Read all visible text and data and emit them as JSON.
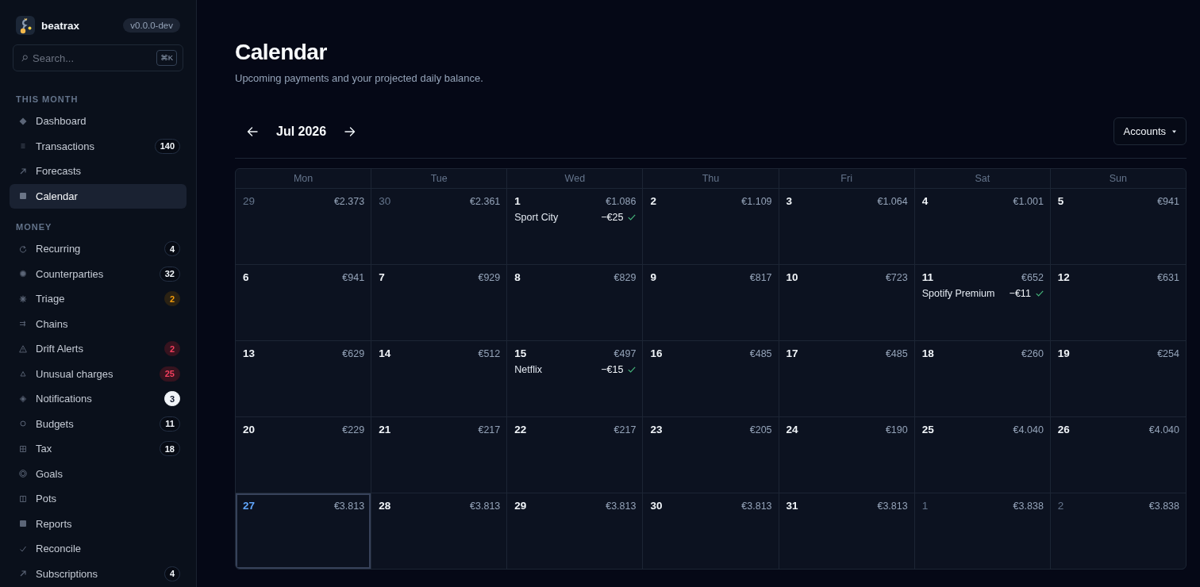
{
  "sidebar": {
    "brand": {
      "name": "beatrax",
      "version": "v0.0.0-dev"
    },
    "search": {
      "placeholder": "Search...",
      "shortcut": "⌘K"
    },
    "sections": [
      {
        "title": "THIS MONTH",
        "items": [
          {
            "label": "Dashboard",
            "selected": false
          },
          {
            "label": "Transactions",
            "selected": false,
            "badge": {
              "count": "140",
              "kind": "neutral"
            }
          },
          {
            "label": "Forecasts",
            "selected": false
          },
          {
            "label": "Calendar",
            "selected": true
          }
        ]
      },
      {
        "title": "MONEY",
        "items": [
          {
            "label": "Recurring",
            "selected": false,
            "badge": {
              "count": "4",
              "kind": "neutral"
            }
          },
          {
            "label": "Counterparties",
            "selected": false,
            "badge": {
              "count": "32",
              "kind": "neutral"
            }
          },
          {
            "label": "Triage",
            "selected": false,
            "badge": {
              "count": "2",
              "kind": "warning"
            }
          },
          {
            "label": "Chains",
            "selected": false
          },
          {
            "label": "Drift Alerts",
            "selected": false,
            "badge": {
              "count": "2",
              "kind": "danger"
            }
          },
          {
            "label": "Unusual charges",
            "selected": false,
            "badge": {
              "count": "25",
              "kind": "danger"
            }
          },
          {
            "label": "Notifications",
            "selected": false,
            "badge": {
              "count": "3",
              "kind": "highlight"
            }
          },
          {
            "label": "Budgets",
            "selected": false,
            "badge": {
              "count": "11",
              "kind": "neutral"
            }
          },
          {
            "label": "Tax",
            "selected": false,
            "badge": {
              "count": "18",
              "kind": "neutral"
            }
          },
          {
            "label": "Goals",
            "selected": false
          },
          {
            "label": "Pots",
            "selected": false
          },
          {
            "label": "Reports",
            "selected": false
          },
          {
            "label": "Reconcile",
            "selected": false
          },
          {
            "label": "Subscriptions",
            "selected": false,
            "badge": {
              "count": "4",
              "kind": "neutral"
            }
          }
        ]
      }
    ]
  },
  "page": {
    "title": "Calendar",
    "subtitle": "Upcoming payments and your projected daily balance."
  },
  "toolbar": {
    "month": "Jul 2026",
    "accounts_button": "Accounts"
  },
  "calendar": {
    "weekdays": [
      "Mon",
      "Tue",
      "Wed",
      "Thu",
      "Fri",
      "Sat",
      "Sun"
    ],
    "weeks": [
      [
        {
          "day": "29",
          "balance": "€2.373",
          "outside_month": true,
          "today": false
        },
        {
          "day": "30",
          "balance": "€2.361",
          "outside_month": true,
          "today": false
        },
        {
          "day": "1",
          "balance": "€1.086",
          "outside_month": false,
          "today": false,
          "events": [
            {
              "name": "Sport City",
              "amount": "−€25",
              "confirmed": true
            }
          ]
        },
        {
          "day": "2",
          "balance": "€1.109",
          "outside_month": false,
          "today": false
        },
        {
          "day": "3",
          "balance": "€1.064",
          "outside_month": false,
          "today": false
        },
        {
          "day": "4",
          "balance": "€1.001",
          "outside_month": false,
          "today": false
        },
        {
          "day": "5",
          "balance": "€941",
          "outside_month": false,
          "today": false
        }
      ],
      [
        {
          "day": "6",
          "balance": "€941",
          "outside_month": false,
          "today": false
        },
        {
          "day": "7",
          "balance": "€929",
          "outside_month": false,
          "today": false
        },
        {
          "day": "8",
          "balance": "€829",
          "outside_month": false,
          "today": false
        },
        {
          "day": "9",
          "balance": "€817",
          "outside_month": false,
          "today": false
        },
        {
          "day": "10",
          "balance": "€723",
          "outside_month": false,
          "today": false
        },
        {
          "day": "11",
          "balance": "€652",
          "outside_month": false,
          "today": false,
          "events": [
            {
              "name": "Spotify Premium",
              "amount": "−€11",
              "confirmed": true
            }
          ]
        },
        {
          "day": "12",
          "balance": "€631",
          "outside_month": false,
          "today": false
        }
      ],
      [
        {
          "day": "13",
          "balance": "€629",
          "outside_month": false,
          "today": false
        },
        {
          "day": "14",
          "balance": "€512",
          "outside_month": false,
          "today": false
        },
        {
          "day": "15",
          "balance": "€497",
          "outside_month": false,
          "today": false,
          "events": [
            {
              "name": "Netflix",
              "amount": "−€15",
              "confirmed": true
            }
          ]
        },
        {
          "day": "16",
          "balance": "€485",
          "outside_month": false,
          "today": false
        },
        {
          "day": "17",
          "balance": "€485",
          "outside_month": false,
          "today": false
        },
        {
          "day": "18",
          "balance": "€260",
          "outside_month": false,
          "today": false
        },
        {
          "day": "19",
          "balance": "€254",
          "outside_month": false,
          "today": false
        }
      ],
      [
        {
          "day": "20",
          "balance": "€229",
          "outside_month": false,
          "today": false
        },
        {
          "day": "21",
          "balance": "€217",
          "outside_month": false,
          "today": false
        },
        {
          "day": "22",
          "balance": "€217",
          "outside_month": false,
          "today": false
        },
        {
          "day": "23",
          "balance": "€205",
          "outside_month": false,
          "today": false
        },
        {
          "day": "24",
          "balance": "€190",
          "outside_month": false,
          "today": false
        },
        {
          "day": "25",
          "balance": "€4.040",
          "outside_month": false,
          "today": false
        },
        {
          "day": "26",
          "balance": "€4.040",
          "outside_month": false,
          "today": false
        }
      ],
      [
        {
          "day": "27",
          "balance": "€3.813",
          "outside_month": false,
          "today": true
        },
        {
          "day": "28",
          "balance": "€3.813",
          "outside_month": false,
          "today": false
        },
        {
          "day": "29",
          "balance": "€3.813",
          "outside_month": false,
          "today": false
        },
        {
          "day": "30",
          "balance": "€3.813",
          "outside_month": false,
          "today": false
        },
        {
          "day": "31",
          "balance": "€3.813",
          "outside_month": false,
          "today": false
        },
        {
          "day": "1",
          "balance": "€3.838",
          "outside_month": true,
          "today": false
        },
        {
          "day": "2",
          "balance": "€3.838",
          "outside_month": true,
          "today": false
        }
      ]
    ]
  }
}
